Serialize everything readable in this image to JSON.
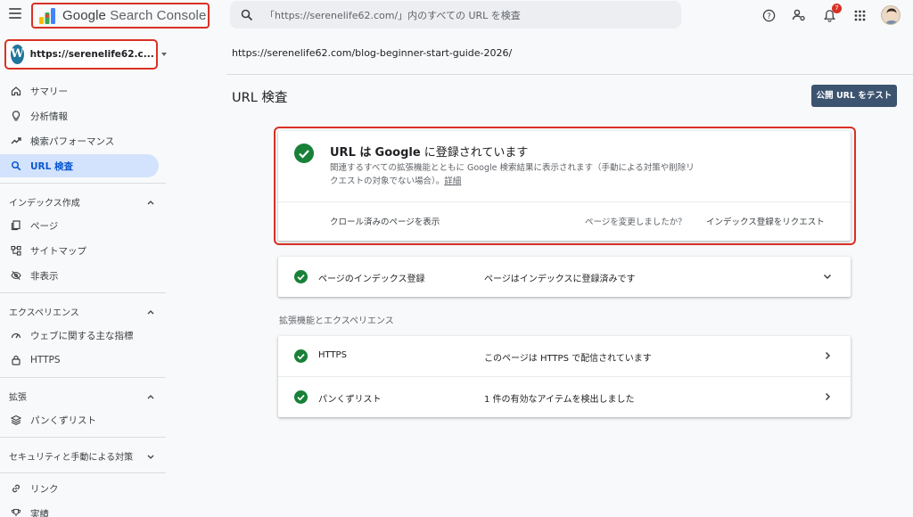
{
  "app": {
    "name_google": "Google",
    "name_product": "Search Console"
  },
  "search": {
    "placeholder": "「https://serenelife62.com/」内のすべての URL を検査"
  },
  "notifications": {
    "count": "7"
  },
  "property": {
    "url": "https://serenelife62.c...",
    "icon_letter": "W"
  },
  "sidebar": {
    "items_top": [
      {
        "label": "サマリー",
        "icon": "home-icon"
      },
      {
        "label": "分析情報",
        "icon": "lightbulb-icon"
      },
      {
        "label": "検索パフォーマンス",
        "icon": "trending-up-icon"
      },
      {
        "label": "URL 検査",
        "icon": "search-icon",
        "active": true
      }
    ],
    "sections": [
      {
        "title": "インデックス作成",
        "items": [
          {
            "label": "ページ",
            "icon": "pages-icon"
          },
          {
            "label": "サイトマップ",
            "icon": "sitemap-icon"
          },
          {
            "label": "非表示",
            "icon": "eye-off-icon"
          }
        ]
      },
      {
        "title": "エクスペリエンス",
        "items": [
          {
            "label": "ウェブに関する主な指標",
            "icon": "speed-icon"
          },
          {
            "label": "HTTPS",
            "icon": "lock-icon"
          }
        ]
      },
      {
        "title": "拡張",
        "items": [
          {
            "label": "パンくずリスト",
            "icon": "layers-icon"
          }
        ]
      },
      {
        "title": "セキュリティと手動による対策",
        "items": []
      }
    ],
    "items_bottom": [
      {
        "label": "リンク",
        "icon": "link-icon"
      },
      {
        "label": "実績",
        "icon": "trophy-icon"
      }
    ]
  },
  "main": {
    "breadcrumb": "https://serenelife62.com/blog-beginner-start-guide-2026/",
    "title": "URL 検査",
    "test_button": "公開 URL をテスト",
    "result": {
      "title_pre": "URL は",
      "title_google": "Google",
      "title_post": "に登録されています",
      "description": "関連するすべての拡張機能とともに Google 検索結果に表示されます（手動による対策や削除リクエストの対象でない場合）。",
      "detail_link": "詳細",
      "crawl_link": "クロール済みのページを表示",
      "changed_question": "ページを変更しましたか？",
      "request_index": "インデックス登録をリクエスト"
    },
    "index_row": {
      "label": "ページのインデックス登録",
      "value": "ページはインデックスに登録済みです"
    },
    "enhancements_label": "拡張機能とエクスペリエンス",
    "enhancements": [
      {
        "label": "HTTPS",
        "value": "このページは HTTPS で配信されています"
      },
      {
        "label": "パンくずリスト",
        "value": "1 件の有効なアイテムを検出しました"
      }
    ]
  },
  "colors": {
    "accent_red": "#d93025",
    "success_green": "#188038",
    "active_nav_bg": "#d3e3fd",
    "button_dark": "#3c5470"
  }
}
